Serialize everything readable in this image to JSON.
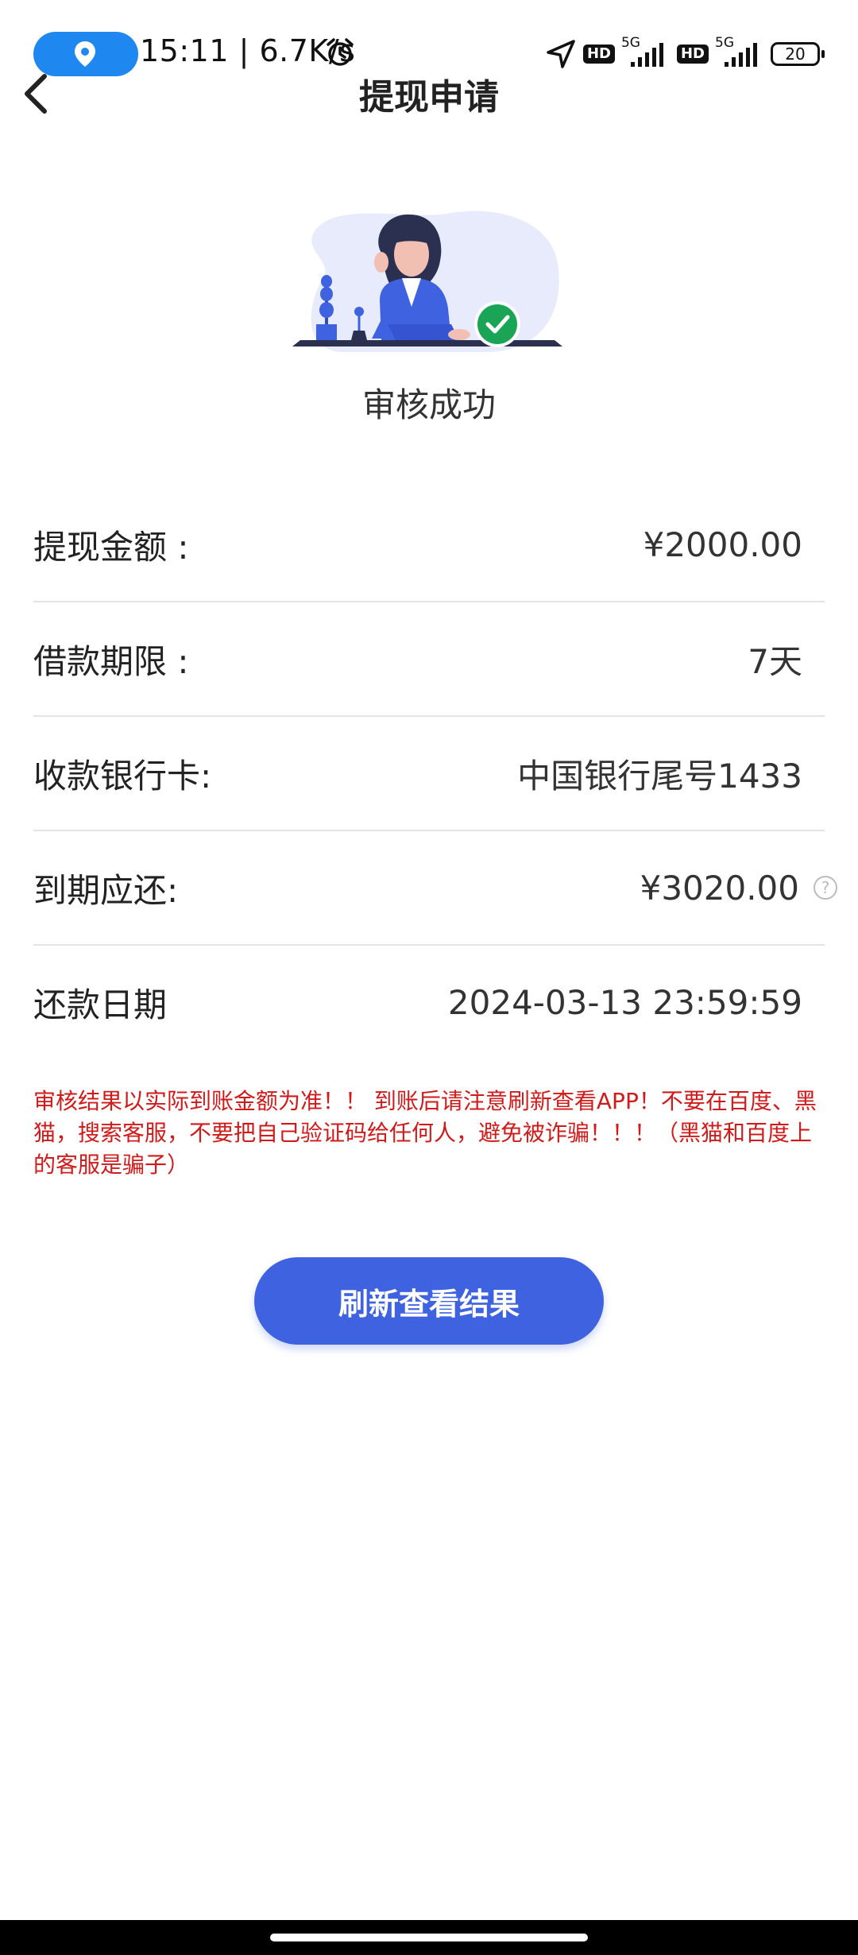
{
  "status_bar": {
    "time_speed": "15:11 | 6.7K/s",
    "hd_badge": "HD",
    "network": "5G",
    "battery": "20",
    "icons": [
      "location-pin-icon",
      "alarm-icon",
      "navigation-arrow-icon",
      "signal-icon",
      "battery-icon"
    ]
  },
  "header": {
    "title": "提现申请",
    "back_icon": "chevron-left-icon"
  },
  "result": {
    "status": "审核成功",
    "accent_color": "#3f63e0",
    "success_color": "#1aa556"
  },
  "details": [
    {
      "label": "提现金额 :",
      "value": "¥2000.00"
    },
    {
      "label": "借款期限 :",
      "value": "7天"
    },
    {
      "label": "收款银行卡:",
      "value": "中国银行尾号1433"
    },
    {
      "label": "到期应还:",
      "value": "¥3020.00",
      "help_icon": "?"
    },
    {
      "label": "还款日期",
      "value": "2024-03-13 23:59:59"
    }
  ],
  "notice": "审核结果以实际到账金额为准！！ 到账后请注意刷新查看APP！不要在百度、黑猫，搜索客服，不要把自己验证码给任何人，避免被诈骗！！！（黑猫和百度上的客服是骗子）",
  "refresh_button": {
    "label": "刷新查看结果"
  }
}
